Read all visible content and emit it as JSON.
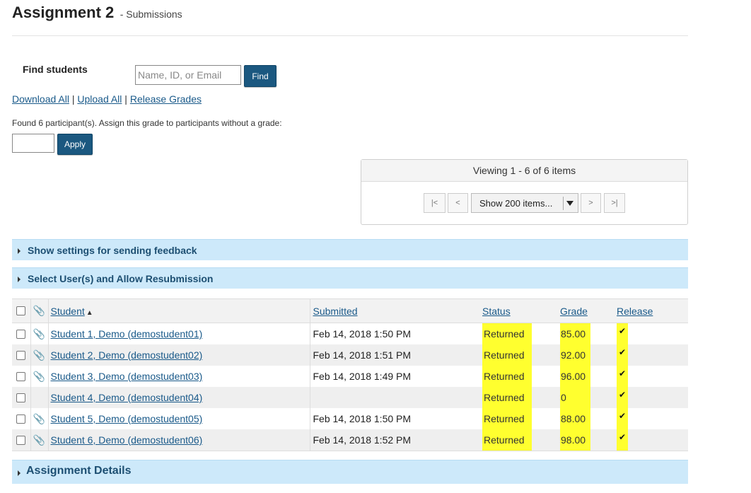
{
  "title": {
    "main": "Assignment 2",
    "sub": "- Submissions"
  },
  "find": {
    "label": "Find students",
    "placeholder": "Name, ID, or Email",
    "button": "Find"
  },
  "links": [
    "Download All",
    "Upload All",
    "Release Grades"
  ],
  "link_sep": "|",
  "grade_assign": {
    "text": "Found 6 participant(s). Assign this grade to participants without a grade:",
    "button": "Apply"
  },
  "pager": {
    "viewing": "Viewing 1 - 6 of 6 items",
    "first": "|<",
    "prev": "<",
    "next": ">",
    "last": ">|",
    "show": "Show 200 items..."
  },
  "sections": {
    "feedback": "Show settings for sending feedback",
    "resubmit": "Select User(s) and Allow Resubmission",
    "details": "Assignment Details"
  },
  "table": {
    "headers": {
      "student": "Student",
      "submitted": "Submitted",
      "status": "Status",
      "grade": "Grade",
      "release": "Release"
    },
    "sort_icon": "sort-ascending-icon",
    "rows": [
      {
        "student": "Student 1, Demo (demostudent01)",
        "submitted": "Feb 14, 2018 1:50 PM",
        "status": "Returned",
        "grade": "85.00",
        "release": "✔",
        "attachment": true
      },
      {
        "student": "Student 2, Demo (demostudent02)",
        "submitted": "Feb 14, 2018 1:51 PM",
        "status": "Returned",
        "grade": "92.00",
        "release": "✔",
        "attachment": true
      },
      {
        "student": "Student 3, Demo (demostudent03)",
        "submitted": "Feb 14, 2018 1:49 PM",
        "status": "Returned",
        "grade": "96.00",
        "release": "✔",
        "attachment": true
      },
      {
        "student": "Student 4, Demo (demostudent04)",
        "submitted": "",
        "status": "Returned",
        "grade": "0",
        "release": "✔",
        "attachment": false
      },
      {
        "student": "Student 5, Demo (demostudent05)",
        "submitted": "Feb 14, 2018 1:50 PM",
        "status": "Returned",
        "grade": "88.00",
        "release": "✔",
        "attachment": true
      },
      {
        "student": "Student 6, Demo (demostudent06)",
        "submitted": "Feb 14, 2018 1:52 PM",
        "status": "Returned",
        "grade": "98.00",
        "release": "✔",
        "attachment": true
      }
    ]
  },
  "colors": {
    "primary_button": "#1b5880",
    "section_bar": "#cde9fa",
    "link": "#1a5a8a",
    "highlight": "#ffff2f"
  }
}
